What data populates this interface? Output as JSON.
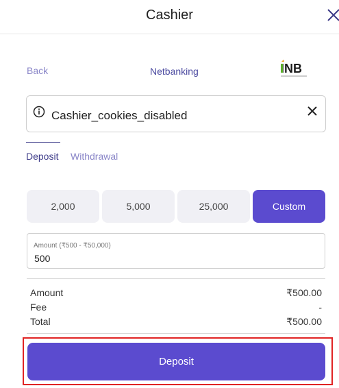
{
  "header": {
    "title": "Cashier",
    "close_icon": "close-icon"
  },
  "subnav": {
    "back_label": "Back",
    "method_label": "Netbanking",
    "logo_text": "INB"
  },
  "alert": {
    "message": "Cashier_cookies_disabled",
    "info_icon": "info-icon",
    "close_icon": "close-icon"
  },
  "tabs": [
    {
      "label": "Deposit",
      "active": true
    },
    {
      "label": "Withdrawal",
      "active": false
    }
  ],
  "amount_options": [
    "2,000",
    "5,000",
    "25,000",
    "Custom"
  ],
  "amount_field": {
    "label": "Amount (₹500 - ₹50,000)",
    "value": "500"
  },
  "summary": {
    "amount_label": "Amount",
    "amount_value": "₹500.00",
    "fee_label": "Fee",
    "fee_value": "-",
    "total_label": "Total",
    "total_value": "₹500.00"
  },
  "deposit_button": {
    "label": "Deposit"
  },
  "colors": {
    "accent": "#5b4bcf",
    "link": "#8a86c8",
    "highlight": "#e02323"
  }
}
